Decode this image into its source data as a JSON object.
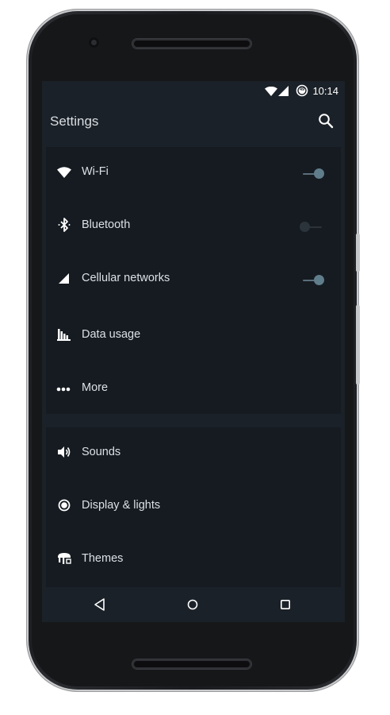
{
  "status_bar": {
    "time": "10:14",
    "battery_level": "49",
    "icons": [
      "wifi-icon",
      "cellular-signal-icon",
      "battery-icon"
    ]
  },
  "toolbar": {
    "title": "Settings",
    "search_icon": "search-icon"
  },
  "sections": [
    {
      "items": [
        {
          "label": "Wi-Fi",
          "icon": "wifi-icon",
          "toggle": "on"
        },
        {
          "label": "Bluetooth",
          "icon": "bluetooth-icon",
          "toggle": "off"
        },
        {
          "label": "Cellular networks",
          "icon": "cellular-signal-icon",
          "toggle": "on"
        },
        {
          "label": "Data usage",
          "icon": "data-usage-icon"
        },
        {
          "label": "More",
          "icon": "more-dots-icon"
        }
      ]
    },
    {
      "items": [
        {
          "label": "Sounds",
          "icon": "volume-icon"
        },
        {
          "label": "Display & lights",
          "icon": "display-icon"
        },
        {
          "label": "Themes",
          "icon": "themes-icon"
        }
      ]
    }
  ],
  "nav_bar": [
    "back-icon",
    "home-icon",
    "recents-icon"
  ],
  "colors": {
    "screen_bg": "#1b2128",
    "card_bg": "#151b21",
    "toggle_on": "#607d8b",
    "text": "#dbe0e5"
  }
}
